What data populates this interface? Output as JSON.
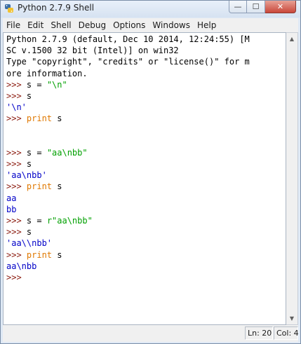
{
  "window": {
    "title": "Python 2.7.9 Shell",
    "buttons": {
      "minimize": "—",
      "maximize": "☐",
      "close": "✕"
    }
  },
  "menu": [
    "File",
    "Edit",
    "Shell",
    "Debug",
    "Options",
    "Windows",
    "Help"
  ],
  "shell_lines": [
    [
      {
        "t": "Python 2.7.9 (default, Dec 10 2014, 12:24:55) [M",
        "c": "code"
      }
    ],
    [
      {
        "t": "SC v.1500 32 bit (Intel)] on win32",
        "c": "code"
      }
    ],
    [
      {
        "t": "Type \"copyright\", \"credits\" or \"license()\" for m",
        "c": "code"
      }
    ],
    [
      {
        "t": "ore information.",
        "c": "code"
      }
    ],
    [
      {
        "t": ">>> ",
        "c": "prompt"
      },
      {
        "t": "s = ",
        "c": "code"
      },
      {
        "t": "\"\\n\"",
        "c": "str"
      }
    ],
    [
      {
        "t": ">>> ",
        "c": "prompt"
      },
      {
        "t": "s",
        "c": "code"
      }
    ],
    [
      {
        "t": "'\\n'",
        "c": "out"
      }
    ],
    [
      {
        "t": ">>> ",
        "c": "prompt"
      },
      {
        "t": "print",
        "c": "kw"
      },
      {
        "t": " s",
        "c": "code"
      }
    ],
    [],
    [],
    [
      {
        "t": ">>> ",
        "c": "prompt"
      },
      {
        "t": "s = ",
        "c": "code"
      },
      {
        "t": "\"aa\\nbb\"",
        "c": "str"
      }
    ],
    [
      {
        "t": ">>> ",
        "c": "prompt"
      },
      {
        "t": "s",
        "c": "code"
      }
    ],
    [
      {
        "t": "'aa\\nbb'",
        "c": "out"
      }
    ],
    [
      {
        "t": ">>> ",
        "c": "prompt"
      },
      {
        "t": "print",
        "c": "kw"
      },
      {
        "t": " s",
        "c": "code"
      }
    ],
    [
      {
        "t": "aa",
        "c": "stdout"
      }
    ],
    [
      {
        "t": "bb",
        "c": "stdout"
      }
    ],
    [
      {
        "t": ">>> ",
        "c": "prompt"
      },
      {
        "t": "s = ",
        "c": "code"
      },
      {
        "t": "r\"aa\\nbb\"",
        "c": "str"
      }
    ],
    [
      {
        "t": ">>> ",
        "c": "prompt"
      },
      {
        "t": "s",
        "c": "code"
      }
    ],
    [
      {
        "t": "'aa\\\\nbb'",
        "c": "out"
      }
    ],
    [
      {
        "t": ">>> ",
        "c": "prompt"
      },
      {
        "t": "print",
        "c": "kw"
      },
      {
        "t": " s",
        "c": "code"
      }
    ],
    [
      {
        "t": "aa\\nbb",
        "c": "stdout"
      }
    ],
    [
      {
        "t": ">>> ",
        "c": "prompt"
      }
    ]
  ],
  "status": {
    "line": "Ln: 20",
    "col": "Col: 4"
  },
  "colors": {
    "prompt": "#8b1a0e",
    "string": "#00a000",
    "keyword": "#e07800",
    "output": "#0000c8"
  }
}
